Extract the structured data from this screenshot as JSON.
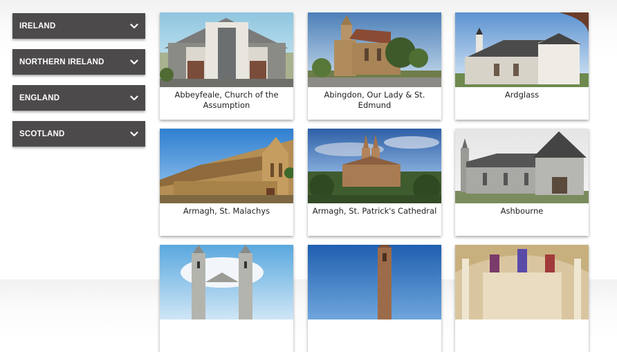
{
  "sidebar": {
    "items": [
      {
        "label": "IRELAND"
      },
      {
        "label": "NORTHERN IRELAND"
      },
      {
        "label": "ENGLAND"
      },
      {
        "label": "SCOTLAND"
      }
    ],
    "icon": "chevron-down-icon"
  },
  "cards": [
    {
      "caption": "Abbeyfeale, Church of the Assumption"
    },
    {
      "caption": "Abingdon, Our Lady & St. Edmund"
    },
    {
      "caption": "Ardglass"
    },
    {
      "caption": "Armagh, St. Malachys"
    },
    {
      "caption": "Armagh, St. Patrick's Cathedral"
    },
    {
      "caption": "Ashbourne"
    },
    {
      "caption": ""
    },
    {
      "caption": ""
    },
    {
      "caption": ""
    }
  ],
  "colors": {
    "accordion_bg": "#4d4a4b",
    "accordion_text": "#ffffff",
    "caption_text": "#222222"
  }
}
